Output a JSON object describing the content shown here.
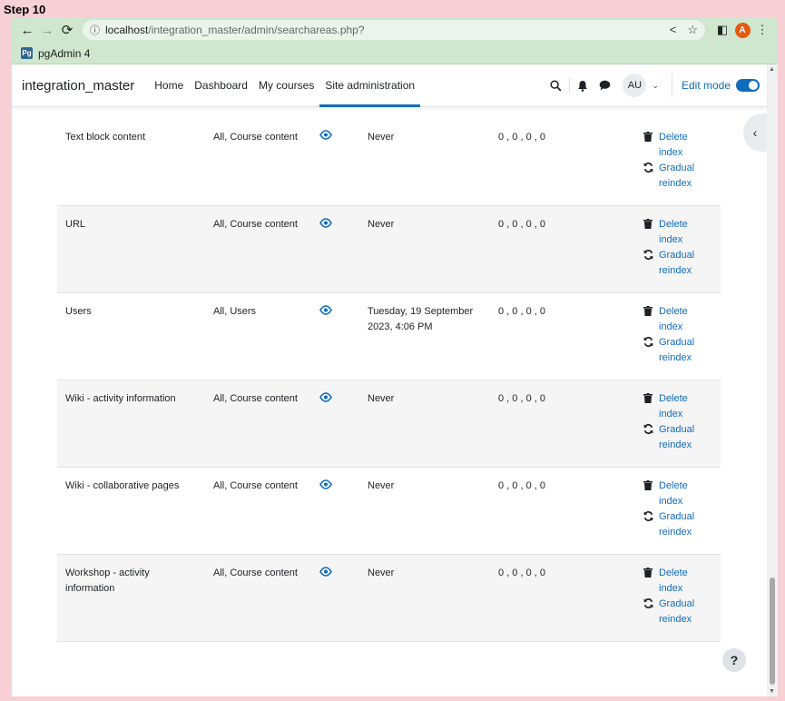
{
  "step_label": "Step 10",
  "browser": {
    "url_host": "localhost",
    "url_path": "/integration_master/admin/searchareas.php?",
    "bookmark_label": "pgAdmin 4",
    "bookmark_icon_text": "Pg",
    "profile_initial": "A"
  },
  "nav": {
    "site_name": "integration_master",
    "links": [
      "Home",
      "Dashboard",
      "My courses",
      "Site administration"
    ],
    "user_initials": "AU",
    "edit_mode_label": "Edit mode"
  },
  "table": {
    "rows": [
      {
        "name": "Text block content",
        "categories": "All, Course content",
        "date": "Never",
        "counts": "0 , 0 , 0 , 0",
        "delete_label": "Delete index",
        "reindex_label": "Gradual reindex"
      },
      {
        "name": "URL",
        "categories": "All, Course content",
        "date": "Never",
        "counts": "0 , 0 , 0 , 0",
        "delete_label": "Delete index",
        "reindex_label": "Gradual reindex"
      },
      {
        "name": "Users",
        "categories": "All, Users",
        "date": "Tuesday, 19 September 2023, 4:06 PM",
        "counts": "0 , 0 , 0 , 0",
        "delete_label": "Delete index",
        "reindex_label": "Gradual reindex"
      },
      {
        "name": "Wiki - activity information",
        "categories": "All, Course content",
        "date": "Never",
        "counts": "0 , 0 , 0 , 0",
        "delete_label": "Delete index",
        "reindex_label": "Gradual reindex"
      },
      {
        "name": "Wiki - collaborative pages",
        "categories": "All, Course content",
        "date": "Never",
        "counts": "0 , 0 , 0 , 0",
        "delete_label": "Delete index",
        "reindex_label": "Gradual reindex"
      },
      {
        "name": "Workshop - activity information",
        "categories": "All, Course content",
        "date": "Never",
        "counts": "0 , 0 , 0 , 0",
        "delete_label": "Delete index",
        "reindex_label": "Gradual reindex"
      }
    ]
  },
  "help_label": "?",
  "colors": {
    "link": "#0f6cbf",
    "stripe": "#f5f5f5",
    "chrome": "#cfe6cf"
  }
}
